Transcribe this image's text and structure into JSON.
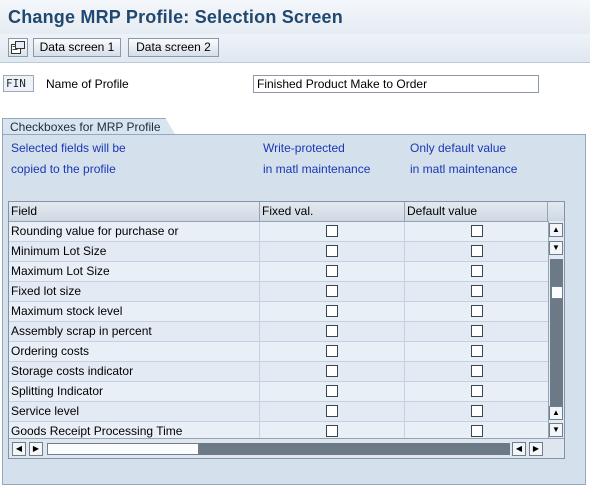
{
  "window": {
    "title": "Change MRP Profile: Selection Screen"
  },
  "toolbar": {
    "icon": "other-object-icon",
    "data_screen_1": "Data screen 1",
    "data_screen_2": "Data screen 2"
  },
  "profile": {
    "code": "FIN",
    "name_label": "Name of Profile",
    "name_value": "Finished Product Make to Order"
  },
  "group": {
    "title": "Checkboxes for MRP Profile",
    "hints": {
      "col1_line1": "Selected fields will be",
      "col1_line2": "copied to the profile",
      "col2_line1": "Write-protected",
      "col2_line2": "in matl maintenance",
      "col3_line1": "Only default value",
      "col3_line2": "in matl maintenance"
    }
  },
  "table": {
    "headers": {
      "field": "Field",
      "fixed": "Fixed val.",
      "default": "Default value"
    },
    "rows": [
      {
        "field": "Rounding value for purchase or",
        "fixed": false,
        "default": false
      },
      {
        "field": "Minimum Lot Size",
        "fixed": false,
        "default": false
      },
      {
        "field": "Maximum Lot Size",
        "fixed": false,
        "default": false
      },
      {
        "field": "Fixed lot size",
        "fixed": false,
        "default": false
      },
      {
        "field": "Maximum stock level",
        "fixed": false,
        "default": false
      },
      {
        "field": "Assembly scrap in percent",
        "fixed": false,
        "default": false
      },
      {
        "field": "Ordering costs",
        "fixed": false,
        "default": false
      },
      {
        "field": "Storage costs indicator",
        "fixed": false,
        "default": false
      },
      {
        "field": "Splitting Indicator",
        "fixed": false,
        "default": false
      },
      {
        "field": "Service level",
        "fixed": false,
        "default": false
      },
      {
        "field": "Goods Receipt Processing Time",
        "fixed": false,
        "default": false
      }
    ]
  },
  "colors": {
    "title": "#21496f",
    "hint_text": "#1a36b4",
    "group_bg": "#d4e1ec"
  }
}
